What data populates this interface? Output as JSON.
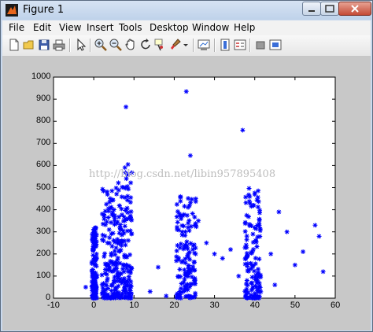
{
  "window": {
    "title": "Figure 1"
  },
  "menu": [
    "File",
    "Edit",
    "View",
    "Insert",
    "Tools",
    "Desktop",
    "Window",
    "Help"
  ],
  "toolbar": [
    "new-figure-icon",
    "open-file-icon",
    "save-icon",
    "print-icon",
    "pointer-icon",
    "zoom-in-icon",
    "zoom-out-icon",
    "pan-icon",
    "rotate-icon",
    "data-cursor-icon",
    "brush-icon",
    "link-plot-icon",
    "colorbar-icon",
    "legend-icon",
    "hide-tools-icon",
    "show-tools-icon"
  ],
  "watermark": "http://blog.csdn.net/libin957895408",
  "colors": {
    "marker": "#0000ff",
    "figure_bg": "#c8c8c8",
    "axes_bg": "#ffffff"
  },
  "chart_data": {
    "type": "scatter",
    "marker": "*",
    "xlim": [
      -10,
      60
    ],
    "ylim": [
      0,
      1000
    ],
    "xticks": [
      "-10",
      "0",
      "10",
      "20",
      "30",
      "40",
      "50",
      "60"
    ],
    "yticks": [
      "0",
      "100",
      "200",
      "300",
      "400",
      "500",
      "600",
      "700",
      "800",
      "900",
      "1000"
    ],
    "grid": false,
    "clusters": [
      {
        "x_range": [
          -0.5,
          0.8
        ],
        "y_range": [
          0,
          320
        ]
      },
      {
        "x_range": [
          2.0,
          6.0
        ],
        "y_range": [
          0,
          500
        ]
      },
      {
        "x_range": [
          6.0,
          9.5
        ],
        "y_range": [
          0,
          600
        ]
      },
      {
        "x_range": [
          20.5,
          25.5
        ],
        "y_range": [
          0,
          480
        ]
      },
      {
        "x_range": [
          37.5,
          41.5
        ],
        "y_range": [
          0,
          500
        ]
      }
    ],
    "outliers": [
      {
        "x": -2,
        "y": 50
      },
      {
        "x": 8,
        "y": 865
      },
      {
        "x": 23,
        "y": 935
      },
      {
        "x": 24,
        "y": 645
      },
      {
        "x": 37,
        "y": 760
      },
      {
        "x": 8.5,
        "y": 605
      },
      {
        "x": 14,
        "y": 30
      },
      {
        "x": 16,
        "y": 140
      },
      {
        "x": 18,
        "y": 10
      },
      {
        "x": 26,
        "y": 350
      },
      {
        "x": 28,
        "y": 250
      },
      {
        "x": 30,
        "y": 200
      },
      {
        "x": 32,
        "y": 180
      },
      {
        "x": 34,
        "y": 220
      },
      {
        "x": 36,
        "y": 100
      },
      {
        "x": 44,
        "y": 200
      },
      {
        "x": 46,
        "y": 390
      },
      {
        "x": 48,
        "y": 300
      },
      {
        "x": 50,
        "y": 150
      },
      {
        "x": 52,
        "y": 210
      },
      {
        "x": 55,
        "y": 330
      },
      {
        "x": 56,
        "y": 280
      },
      {
        "x": 57,
        "y": 120
      },
      {
        "x": 45,
        "y": 60
      }
    ]
  }
}
